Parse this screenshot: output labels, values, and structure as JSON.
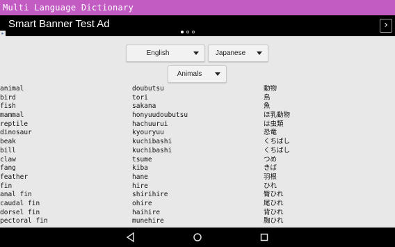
{
  "app": {
    "title": "Multi Language Dictionary"
  },
  "ad": {
    "text": "Smart Banner Test Ad",
    "next": "›"
  },
  "selectors": {
    "source_language": "English",
    "target_language": "Japanese",
    "category": "Animals"
  },
  "entries": [
    [
      "animal",
      "doubutsu",
      "動物"
    ],
    [
      "bird",
      "tori",
      "鳥"
    ],
    [
      "fish",
      "sakana",
      "魚"
    ],
    [
      "mammal",
      "honyuudoubutsu",
      "ほ乳動物"
    ],
    [
      "reptile",
      "hachuurui",
      "は虫類"
    ],
    [
      "dinosaur",
      "kyouryuu",
      "恐竜"
    ],
    [
      "beak",
      "kuchibashi",
      "くちばし"
    ],
    [
      "bill",
      "kuchibashi",
      "くちばし"
    ],
    [
      "claw",
      "tsume",
      "つめ"
    ],
    [
      "fang",
      "kiba",
      "きば"
    ],
    [
      "feather",
      "hane",
      "羽根"
    ],
    [
      "fin",
      "hire",
      "ひれ"
    ],
    [
      "anal fin",
      "shirihire",
      "臀ひれ"
    ],
    [
      "caudal fin",
      "ohire",
      "尾ひれ"
    ],
    [
      "dorsel fin",
      "haihire",
      "背ひれ"
    ],
    [
      "pectoral fin",
      "munehire",
      "胸ひれ"
    ]
  ]
}
